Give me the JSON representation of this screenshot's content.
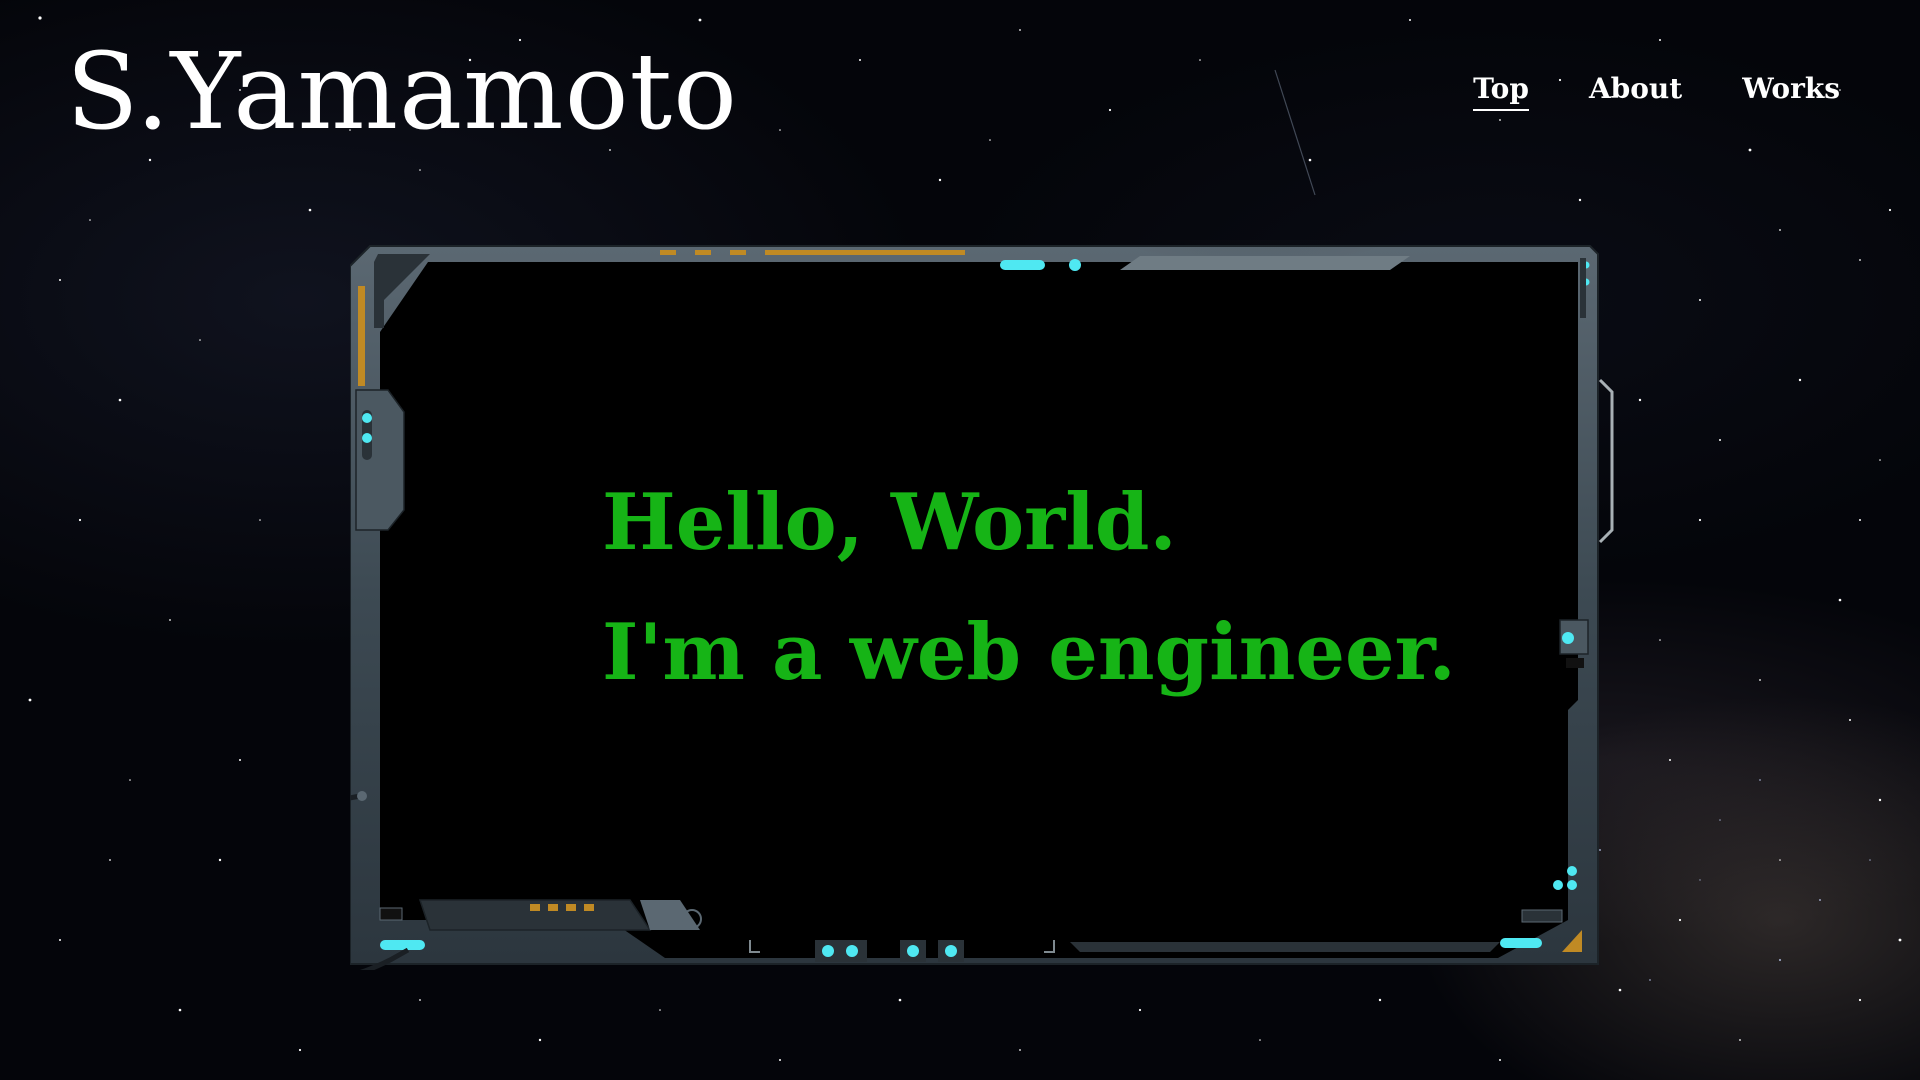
{
  "site": {
    "title": "S.Yamamoto"
  },
  "nav": {
    "items": [
      {
        "label": "Top",
        "active": true
      },
      {
        "label": "About",
        "active": false
      },
      {
        "label": "Works",
        "active": false
      }
    ]
  },
  "screen": {
    "line1": "Hello, World.",
    "line2": "I'm a web engineer."
  },
  "colors": {
    "background": "#04050a",
    "text_primary": "#ffffff",
    "screen_text": "#16b416",
    "frame_metal": "#3e4b55",
    "frame_accent_cyan": "#4fe8f2",
    "frame_accent_orange": "#c08a24"
  }
}
